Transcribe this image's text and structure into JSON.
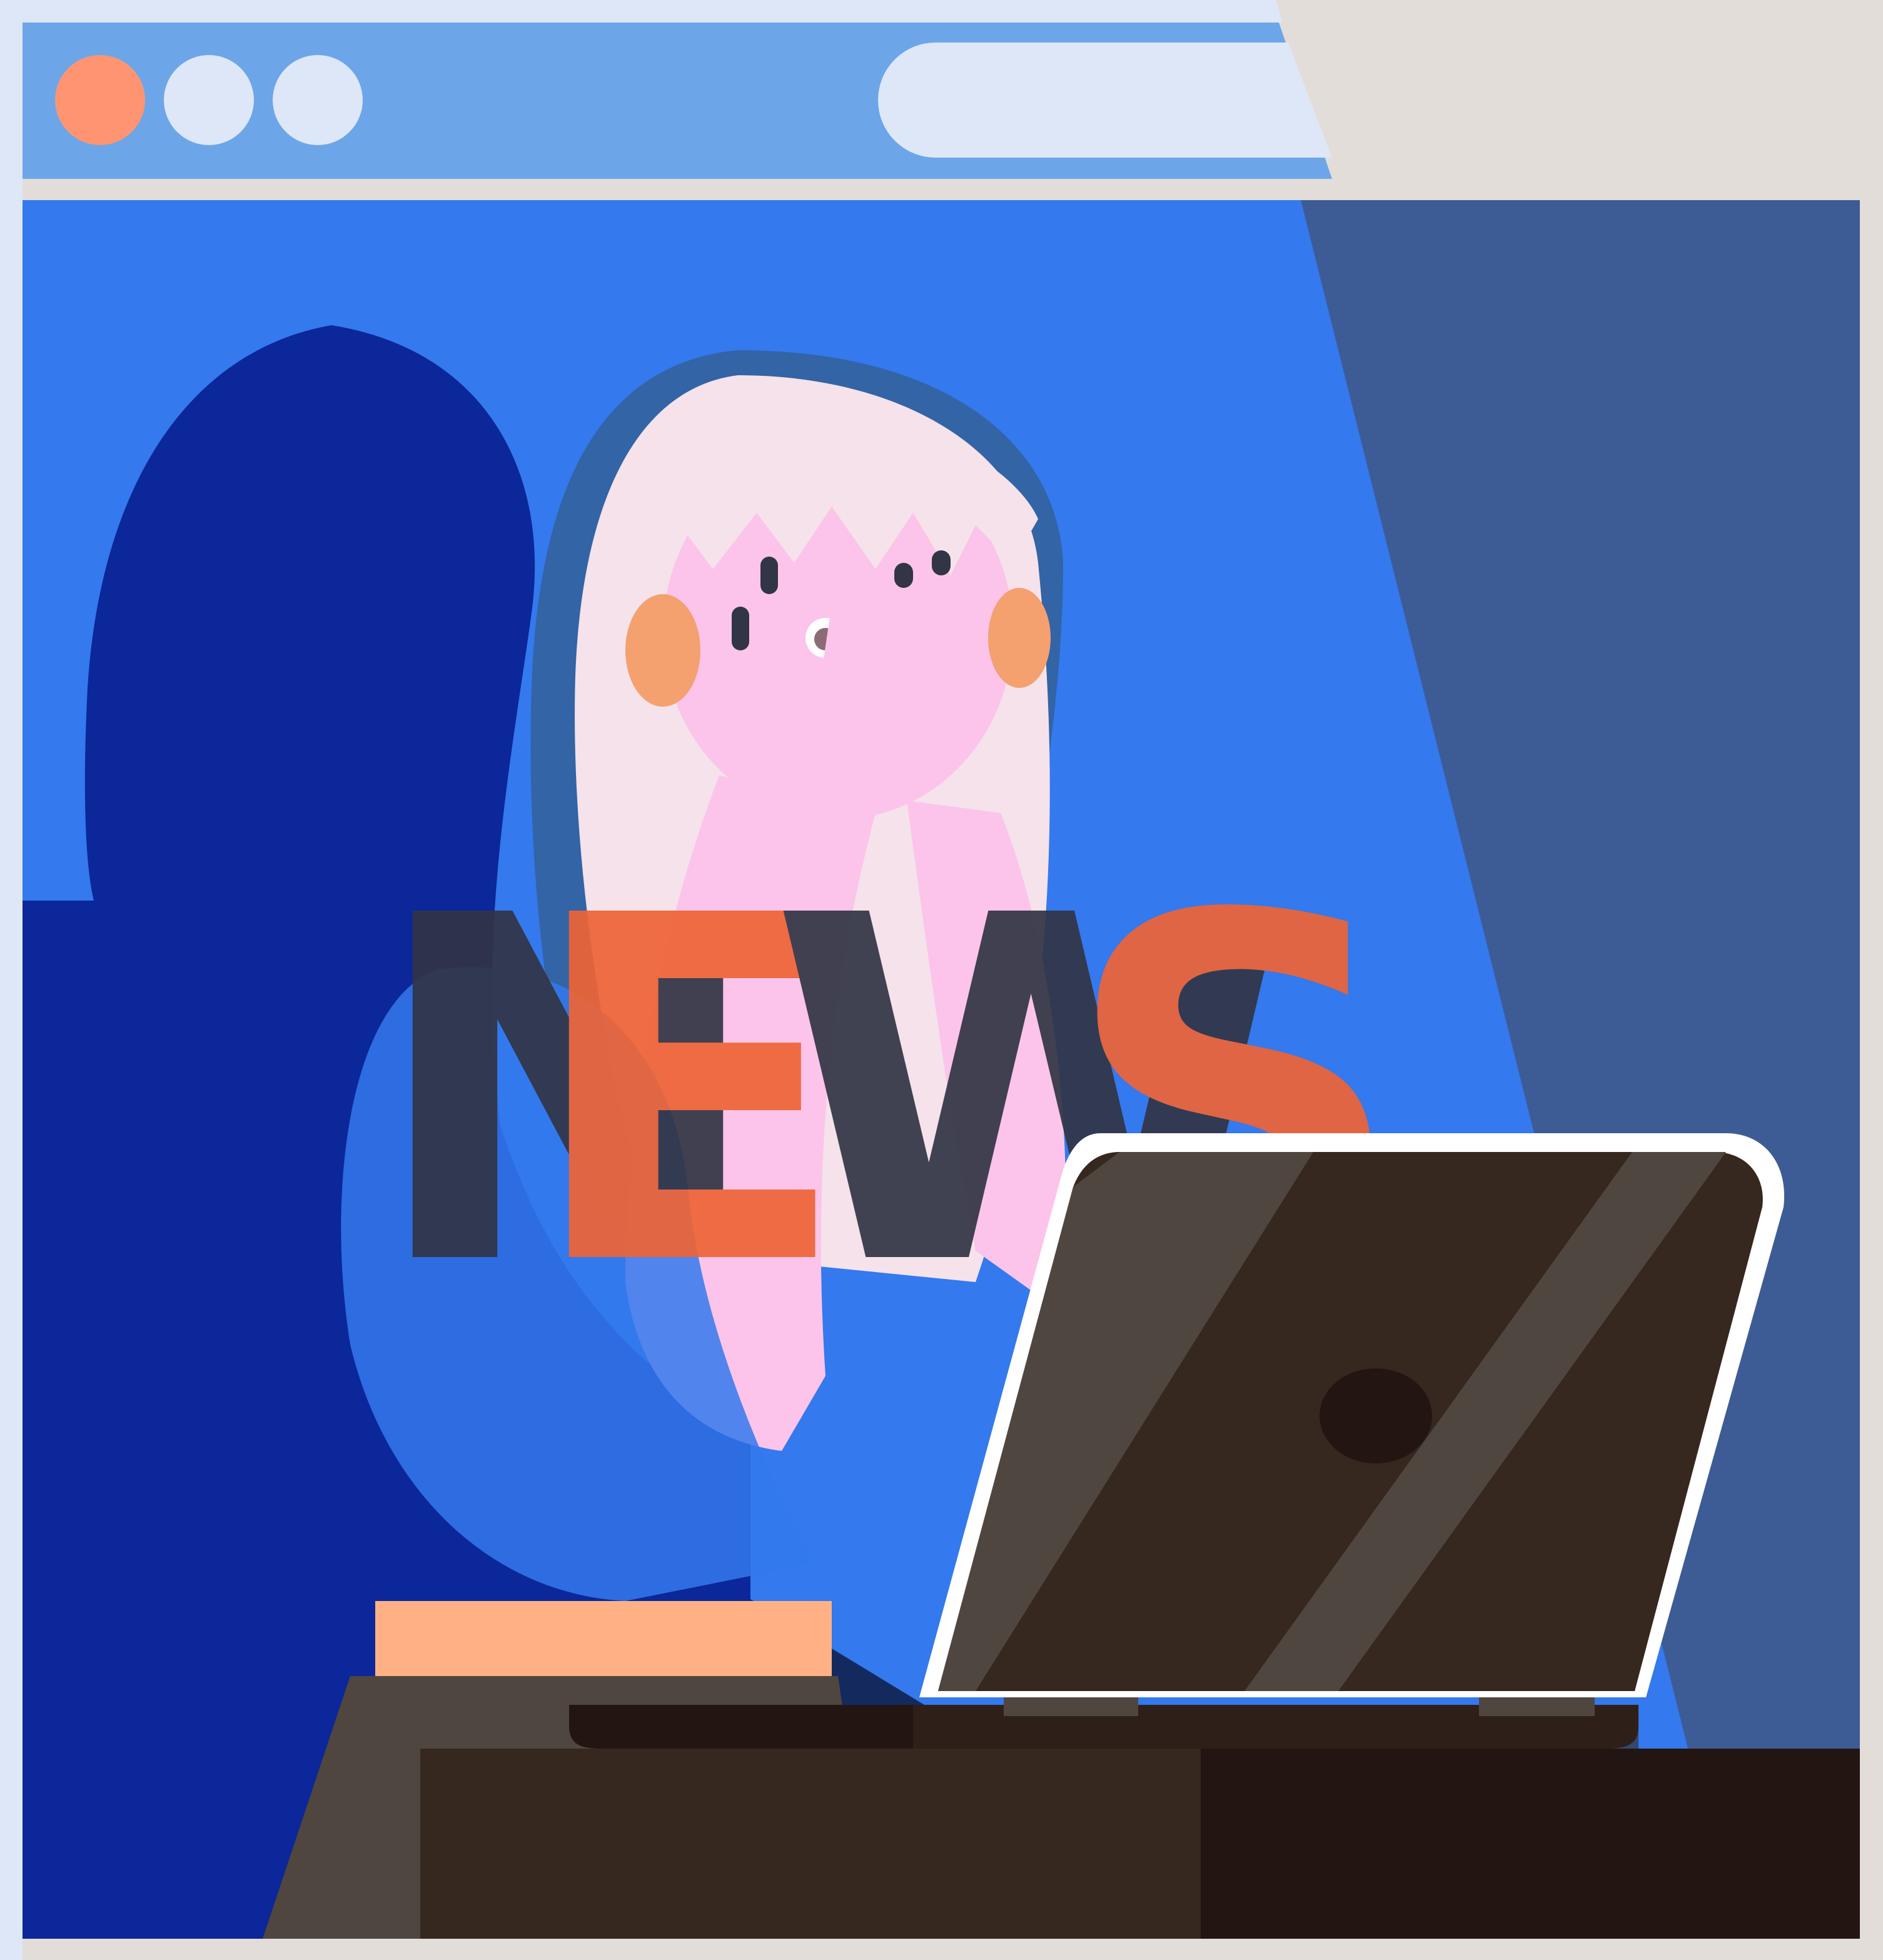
{
  "window": {
    "controls": [
      {
        "name": "close-dot",
        "color": "#ff9472"
      },
      {
        "name": "minimize-dot",
        "color": "#dde7f7"
      },
      {
        "name": "maximize-dot",
        "color": "#dde7f7"
      }
    ],
    "title_bar_color": "#6ca6e8",
    "address_bar_color": "#dde7f7",
    "viewport_color": "#3479ed"
  },
  "illustration": {
    "headline": {
      "letters": [
        "N",
        "E",
        "W",
        "S"
      ],
      "letter_colors": [
        "#313545",
        "#ee6436",
        "#313545",
        "#ee6436"
      ]
    },
    "subject": "woman-covering-face-at-laptop",
    "icons": [
      "laptop-icon",
      "woman-figure",
      "shadow-figure",
      "desk"
    ],
    "colors": {
      "skin": "#fcc4ea",
      "hair": "#f5e2ea",
      "shadow": "#0b2799",
      "laptop": "#36271f",
      "desk": "#36271f",
      "light_beam": "#3d5c96"
    }
  }
}
